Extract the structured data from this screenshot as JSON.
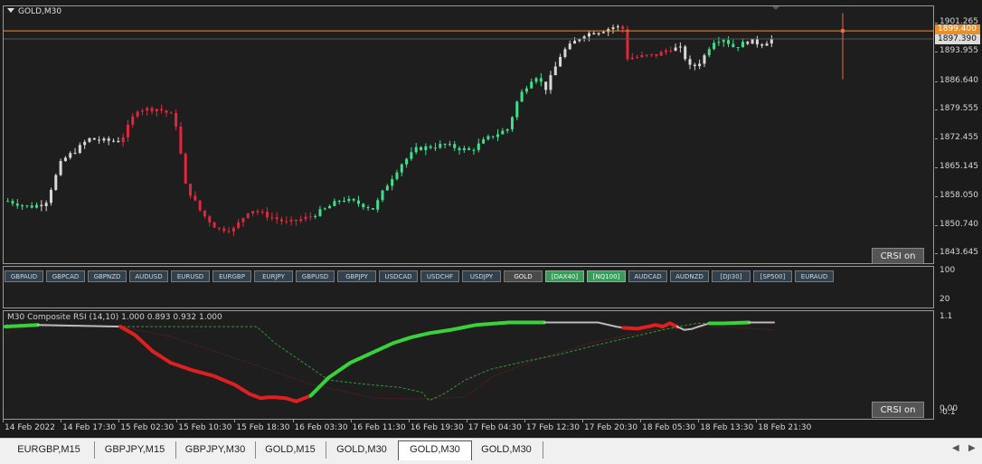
{
  "window": {
    "title": "GOLD,M30"
  },
  "price_scale": {
    "labels": [
      "1901.265",
      "1893.955",
      "1886.640",
      "1879.555",
      "1872.455",
      "1865.145",
      "1858.050",
      "1850.740",
      "1843.645"
    ],
    "bid_label": "1899.400",
    "current_label": "1897.390"
  },
  "indicator_scale": {
    "labels": [
      "100",
      "20"
    ]
  },
  "rsi_scale": {
    "labels": [
      "1.1",
      "0.00"
    ],
    "overlap_label": "-0.1"
  },
  "symbol_buttons": [
    {
      "label": "GBPAUD",
      "style": "normal"
    },
    {
      "label": "GBPCAD",
      "style": "normal"
    },
    {
      "label": "GBPNZD",
      "style": "normal"
    },
    {
      "label": "AUDUSD",
      "style": "normal"
    },
    {
      "label": "EURUSD",
      "style": "normal"
    },
    {
      "label": "EURGBP",
      "style": "normal"
    },
    {
      "label": "EURJPY",
      "style": "normal"
    },
    {
      "label": "GBPUSD",
      "style": "normal"
    },
    {
      "label": "GBPJPY",
      "style": "normal"
    },
    {
      "label": "USDCAD",
      "style": "normal"
    },
    {
      "label": "USDCHF",
      "style": "normal"
    },
    {
      "label": "USDJPY",
      "style": "normal"
    },
    {
      "label": "GOLD",
      "style": "gray"
    },
    {
      "label": "[DAX40]",
      "style": "green"
    },
    {
      "label": "[NQ100]",
      "style": "green"
    },
    {
      "label": "AUDCAD",
      "style": "normal"
    },
    {
      "label": "AUDNZD",
      "style": "normal"
    },
    {
      "label": "[DJI30]",
      "style": "normal"
    },
    {
      "label": "[SP500]",
      "style": "normal"
    },
    {
      "label": "EURAUD",
      "style": "normal"
    }
  ],
  "crsi_button_label": "CRSI on",
  "rsi_indicator_label": "M30 Composite RSI (14,10) 1.000 0.893 0.932 1.000",
  "time_labels": [
    "14 Feb 2022",
    "14 Feb 17:30",
    "15 Feb 02:30",
    "15 Feb 10:30",
    "15 Feb 18:30",
    "16 Feb 03:30",
    "16 Feb 11:30",
    "16 Feb 19:30",
    "17 Feb 04:30",
    "17 Feb 12:30",
    "17 Feb 20:30",
    "18 Feb 05:30",
    "18 Feb 13:30",
    "18 Feb 21:30"
  ],
  "tabs": [
    {
      "label": "EURGBP,M15",
      "active": false
    },
    {
      "label": "GBPJPY,M15",
      "active": false
    },
    {
      "label": "GBPJPY,M30",
      "active": false
    },
    {
      "label": "GOLD,M15",
      "active": false
    },
    {
      "label": "GOLD,M30",
      "active": false
    },
    {
      "label": "GOLD,M30",
      "active": true
    },
    {
      "label": "GOLD,M30",
      "active": false
    }
  ],
  "icons": [
    "dropdown-triangle-icon",
    "scroll-left-icon",
    "scroll-right-icon"
  ],
  "colors": {
    "background": "#1e1e1e",
    "bull": "#3fe08a",
    "bear": "#e0283c",
    "neutral": "#d8d8d8",
    "bid_line": "#e8902a",
    "rsi_up": "#3ad23a",
    "rsi_down": "#e02020",
    "rsi_neutral": "#bbbbbb",
    "signal_green": "#2d9a2d",
    "signal_red": "#8a2020"
  },
  "chart_data": [
    {
      "type": "candlestick",
      "title": "GOLD,M30",
      "xlabel": "",
      "ylabel": "",
      "ylim": [
        1841.5,
        1905.5
      ],
      "bar_count": 160,
      "price_path": [
        [
          0,
          1857
        ],
        [
          8,
          1855.5
        ],
        [
          14,
          1856.5
        ],
        [
          20,
          1867
        ],
        [
          26,
          1870
        ],
        [
          30,
          1872.5
        ],
        [
          36,
          1872
        ],
        [
          42,
          1872
        ],
        [
          48,
          1879.8
        ],
        [
          56,
          1880
        ],
        [
          62,
          1878
        ],
        [
          64,
          1870
        ],
        [
          66,
          1861
        ],
        [
          72,
          1854
        ],
        [
          78,
          1850
        ],
        [
          84,
          1850
        ],
        [
          90,
          1855
        ],
        [
          96,
          1853.5
        ],
        [
          104,
          1851.5
        ],
        [
          112,
          1853
        ],
        [
          118,
          1855
        ],
        [
          124,
          1857.5
        ],
        [
          130,
          1856.5
        ],
        [
          136,
          1855
        ],
        [
          140,
          1860
        ],
        [
          146,
          1866
        ],
        [
          152,
          1870
        ],
        [
          162,
          1871
        ],
        [
          172,
          1869.5
        ],
        [
          178,
          1872.5
        ],
        [
          186,
          1875
        ],
        [
          190,
          1883
        ],
        [
          196,
          1888.5
        ],
        [
          200,
          1885
        ],
        [
          206,
          1894
        ],
        [
          214,
          1898.5
        ],
        [
          220,
          1899.3
        ],
        [
          226,
          1900.5
        ],
        [
          229,
          1899.8
        ],
        [
          230,
          1892.6
        ],
        [
          236,
          1893
        ],
        [
          242,
          1893.5
        ],
        [
          246,
          1895
        ],
        [
          250,
          1895
        ],
        [
          254,
          1890
        ],
        [
          258,
          1892
        ],
        [
          262,
          1896.8
        ],
        [
          266,
          1897.5
        ],
        [
          270,
          1895.3
        ],
        [
          276,
          1897
        ],
        [
          280,
          1896
        ],
        [
          284,
          1897.3
        ]
      ]
    },
    {
      "type": "line",
      "title": "M30 Composite RSI (14,10)",
      "xlabel": "",
      "ylabel": "",
      "ylim": [
        0,
        1.1
      ],
      "series": [
        {
          "name": "",
          "points": [
            [
              0,
              1.0
            ],
            [
              18,
              1.02
            ],
            [
              64,
              1.0
            ],
            [
              72,
              0.9
            ],
            [
              82,
              0.7
            ],
            [
              92,
              0.56
            ],
            [
              104,
              0.47
            ],
            [
              116,
              0.4
            ],
            [
              128,
              0.29
            ],
            [
              136,
              0.18
            ],
            [
              142,
              0.13
            ],
            [
              146,
              0.14
            ],
            [
              150,
              0.14
            ],
            [
              156,
              0.13
            ],
            [
              162,
              0.09
            ],
            [
              170,
              0.16
            ],
            [
              180,
              0.38
            ],
            [
              192,
              0.56
            ],
            [
              204,
              0.68
            ],
            [
              216,
              0.8
            ],
            [
              226,
              0.87
            ],
            [
              236,
              0.92
            ],
            [
              248,
              0.96
            ],
            [
              262,
              1.02
            ],
            [
              280,
              1.05
            ],
            [
              300,
              1.05
            ],
            [
              320,
              1.05
            ],
            [
              330,
              1.05
            ],
            [
              336,
              1.02
            ],
            [
              340,
              1.0
            ],
            [
              344,
              0.985
            ],
            [
              352,
              0.975
            ],
            [
              358,
              1.0
            ],
            [
              362,
              1.02
            ],
            [
              366,
              1.0
            ],
            [
              370,
              1.04
            ],
            [
              374,
              1.0
            ],
            [
              378,
              0.96
            ],
            [
              382,
              0.97
            ],
            [
              386,
              1.0
            ],
            [
              392,
              1.04
            ],
            [
              400,
              1.04
            ],
            [
              414,
              1.05
            ],
            [
              428,
              1.05
            ]
          ],
          "segments": [
            {
              "from": 0,
              "to": 18,
              "state": "up"
            },
            {
              "from": 18,
              "to": 64,
              "state": "flat"
            },
            {
              "from": 64,
              "to": 170,
              "state": "down"
            },
            {
              "from": 170,
              "to": 300,
              "state": "up"
            },
            {
              "from": 300,
              "to": 344,
              "state": "flat"
            },
            {
              "from": 344,
              "to": 374,
              "state": "down"
            },
            {
              "from": 374,
              "to": 392,
              "state": "flat"
            },
            {
              "from": 392,
              "to": 414,
              "state": "up"
            },
            {
              "from": 414,
              "to": 428,
              "state": "flat"
            }
          ]
        },
        {
          "name": "",
          "style": "dashed",
          "points": [
            [
              0,
              1.02
            ],
            [
              60,
              1.0
            ],
            [
              140,
              1.0
            ],
            [
              150,
              0.8
            ],
            [
              170,
              0.5
            ],
            [
              180,
              0.35
            ],
            [
              200,
              0.3
            ],
            [
              220,
              0.26
            ],
            [
              232,
              0.2
            ],
            [
              236,
              0.1
            ],
            [
              244,
              0.18
            ],
            [
              256,
              0.35
            ],
            [
              270,
              0.48
            ],
            [
              290,
              0.58
            ],
            [
              310,
              0.67
            ],
            [
              330,
              0.78
            ],
            [
              350,
              0.88
            ],
            [
              370,
              0.98
            ],
            [
              385,
              1.04
            ],
            [
              428,
              1.05
            ]
          ]
        },
        {
          "name": "",
          "style": "dotted",
          "points": [
            [
              0,
              0.92
            ],
            [
              12,
              1.0
            ],
            [
              64,
              1.0
            ],
            [
              92,
              0.88
            ],
            [
              130,
              0.6
            ],
            [
              170,
              0.3
            ],
            [
              206,
              0.13
            ],
            [
              228,
              0.12
            ],
            [
              250,
              0.14
            ],
            [
              256,
              0.14
            ],
            [
              272,
              0.4
            ],
            [
              296,
              0.6
            ],
            [
              326,
              0.8
            ],
            [
              360,
              0.96
            ],
            [
              400,
              1.0
            ],
            [
              428,
              0.96
            ]
          ]
        }
      ]
    }
  ]
}
